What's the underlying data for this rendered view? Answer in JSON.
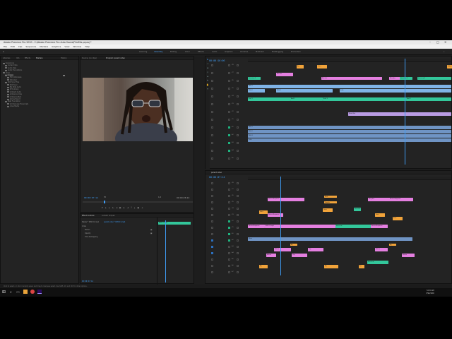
{
  "window": {
    "title": "Adobe Premiere Pro 2020 - C:\\Adobe Premiere Pro Auto Saves\\FilmMix.prproj *",
    "controls": [
      "–",
      "□",
      "✕"
    ]
  },
  "menu": [
    "File",
    "Edit",
    "Clip",
    "Sequence",
    "Markers",
    "Graphics",
    "View",
    "Window",
    "Help"
  ],
  "workspaces": {
    "home_icon": "home-icon",
    "tabs": [
      "Learning",
      "Assembly",
      "Editing",
      "Color",
      "Effects",
      "Audio",
      "Graphics",
      "Libraries",
      "Multicam",
      "Metalogging",
      "Production"
    ],
    "active": "Assembly"
  },
  "project_panel": {
    "tabs": [
      "Libraries",
      "Info",
      "Effects",
      "Markers",
      "History"
    ],
    "items": [
      {
        "label": "Sequences",
        "indent": 0
      },
      {
        "label": "Locked Clips",
        "indent": 1
      },
      {
        "label": "Audio Clips",
        "indent": 1
      },
      {
        "label": "Audio Foundations",
        "indent": 1
      },
      {
        "label": "Video",
        "indent": 0
      },
      {
        "label": "Images",
        "indent": 1
      },
      {
        "label": "Film Interviews",
        "indent": 2
      },
      {
        "label": "Kiki Joker",
        "indent": 2
      },
      {
        "label": "Wild Sync Files",
        "indent": 1
      },
      {
        "label": "Wild Sync",
        "indent": 2
      },
      {
        "label": "BG Stills Audio",
        "indent": 2
      },
      {
        "label": "SFX Library",
        "indent": 2
      },
      {
        "label": "Ambient Audio",
        "indent": 2
      },
      {
        "label": "Ambience Clips",
        "indent": 2
      },
      {
        "label": "Ambience Bed",
        "indent": 2
      },
      {
        "label": "Atmos Export",
        "indent": 2
      },
      {
        "label": "Beat Foundation",
        "indent": 1
      },
      {
        "label": "All Interview Transcripts",
        "indent": 2
      },
      {
        "label": "Lines Media",
        "indent": 2
      }
    ]
  },
  "source_monitor": {
    "tab_source": "Source: (no clips)",
    "tab_program": "Program: parent video",
    "timecode_left": "00:00:07:14",
    "fit": "Fit",
    "ratio": "1/2",
    "timecode_right": "00:00:26:14"
  },
  "effect_controls": {
    "tabs": [
      "Effect Controls",
      "Lumetri Scopes"
    ],
    "master": "Master * RMX 01.mp4",
    "clip": "parent video * RMX 01.mp4",
    "rows": [
      "Video",
      "Motion",
      "Opacity",
      "Time Remapping"
    ],
    "clip_bar": "RMX 01.mp4",
    "timecode": "00:00:07:14"
  },
  "timeline_top": {
    "timecode": "00:00:16:06",
    "tracks": [
      "V8",
      "V7",
      "V6",
      "V5",
      "V4",
      "V3",
      "V2",
      "V1",
      "A1",
      "A2",
      "A3",
      "A4",
      "A5"
    ],
    "clips": [
      {
        "label": "Bg",
        "color": "orange"
      },
      {
        "label": "Lines",
        "color": "orange"
      },
      {
        "label": "Adjust",
        "color": "orange"
      },
      {
        "label": "Kiki title",
        "color": "pink"
      },
      {
        "label": "Interview 1",
        "color": "green"
      },
      {
        "label": "Kiki Joker",
        "color": "pink"
      },
      {
        "label": "Interview 2",
        "color": "green"
      },
      {
        "label": "Interview 3",
        "color": "green"
      },
      {
        "label": "Wild 1",
        "color": "blue"
      },
      {
        "label": "Wild 2",
        "color": "blue"
      },
      {
        "label": "Wild 3",
        "color": "blue"
      },
      {
        "label": "Stills",
        "color": "blue"
      },
      {
        "label": "Broll 1",
        "color": "green"
      },
      {
        "label": "Broll 2",
        "color": "green"
      },
      {
        "label": "Broll 3",
        "color": "green"
      },
      {
        "label": "Music Bed",
        "color": "violet"
      }
    ]
  },
  "timeline_bottom": {
    "tab": "parent video",
    "timecode": "00:00:07:14",
    "tracks": [
      "V8",
      "V7",
      "V6",
      "V5",
      "V4",
      "V3",
      "V2",
      "V1",
      "A1",
      "A2",
      "A3",
      "A4",
      "A5",
      "A6",
      "A7"
    ],
    "clips": [
      {
        "label": "Nested Sequence",
        "color": "pink"
      },
      {
        "label": "Rock",
        "color": "orange"
      },
      {
        "label": "Graphic",
        "color": "orange"
      },
      {
        "label": "Nested Sequence",
        "color": "pink"
      },
      {
        "label": "Lines",
        "color": "orange"
      },
      {
        "label": "Kiki Joker",
        "color": "pink"
      },
      {
        "label": "Interview",
        "color": "green"
      },
      {
        "label": "RMX 01.mp4",
        "color": "pink"
      },
      {
        "label": "Bg",
        "color": "orange"
      },
      {
        "label": "Music",
        "color": "audio"
      },
      {
        "label": "Effects",
        "color": "pink"
      },
      {
        "label": "Clip",
        "color": "pink"
      }
    ]
  },
  "status": {
    "text": "Click to select, or click in empty space and drag to marquee select. Use Shift, Alt, and Ctrl for other options."
  },
  "taskbar": {
    "clock": "5:03 AM",
    "date": "7/9/2020"
  }
}
